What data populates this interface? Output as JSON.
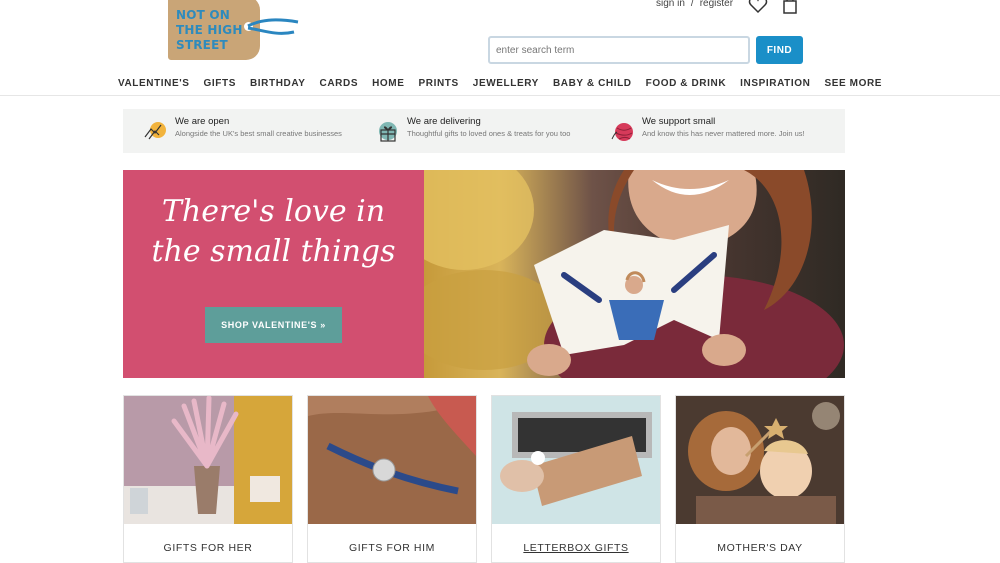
{
  "brand": {
    "logo_lines": [
      "NOT ON",
      "THE HIGH",
      "STREET"
    ]
  },
  "account": {
    "sign_in": "sign in",
    "separator": "/",
    "register": "register"
  },
  "icons": {
    "wishlist": "heart-icon",
    "basket": "shopping-bag-icon"
  },
  "search": {
    "placeholder": "enter search term",
    "button": "FIND"
  },
  "nav": [
    "VALENTINE'S",
    "GIFTS",
    "BIRTHDAY",
    "CARDS",
    "HOME",
    "PRINTS",
    "JEWELLERY",
    "BABY & CHILD",
    "FOOD & DRINK",
    "INSPIRATION",
    "SEE MORE"
  ],
  "info": [
    {
      "title": "We are open",
      "subtitle": "Alongside the UK's best small creative businesses",
      "icon": "hands-icon"
    },
    {
      "title": "We are delivering",
      "subtitle": "Thoughtful gifts to loved ones & treats for you too",
      "icon": "gift-parcel-icon"
    },
    {
      "title": "We support small",
      "subtitle": "And know this has never mattered more. Join us!",
      "icon": "yarn-ball-icon"
    }
  ],
  "hero": {
    "headline_line1": "There's love in",
    "headline_line2": "the small things",
    "button": "SHOP VALENTINE'S »"
  },
  "cards": [
    {
      "label": "GIFTS FOR HER"
    },
    {
      "label": "GIFTS FOR HIM"
    },
    {
      "label": "LETTERBOX GIFTS"
    },
    {
      "label": "MOTHER'S DAY"
    }
  ],
  "colors": {
    "brand_blue": "#1a8fc8",
    "hero_pink": "#d24f70",
    "hero_button": "#5e9e9a",
    "logo_tag": "#c9a577"
  }
}
